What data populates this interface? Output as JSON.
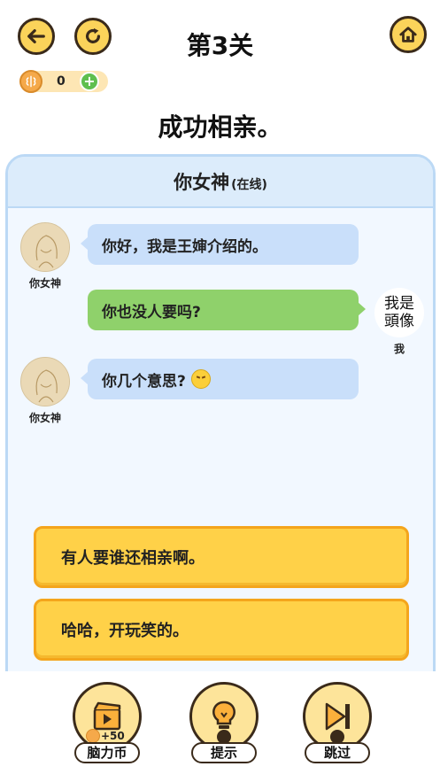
{
  "header": {
    "level_title": "第3关",
    "coins": "0"
  },
  "question": "成功相亲。",
  "chat": {
    "contact_name": "你女神",
    "status": "(在线)",
    "messages": [
      {
        "side": "left",
        "sender": "你女神",
        "text": "你好，我是王婶介绍的。"
      },
      {
        "side": "right",
        "sender": "我",
        "text": "你也没人要吗?"
      },
      {
        "side": "left",
        "sender": "你女神",
        "text": "你几个意思?"
      }
    ],
    "self_avatar_text": [
      "我是",
      "頭像"
    ]
  },
  "options": [
    {
      "text": "有人要谁还相亲啊。"
    },
    {
      "text": "哈哈，开玩笑的。"
    }
  ],
  "toolbar": {
    "brain_coin_label": "脑力币",
    "brain_coin_bonus": "+50",
    "hint_label": "提示",
    "skip_label": "跳过"
  },
  "colors": {
    "button_yellow": "#fbd35a",
    "option_yellow": "#ffd148",
    "bubble_blue": "#c9dffa",
    "bubble_green": "#8fd16b"
  }
}
